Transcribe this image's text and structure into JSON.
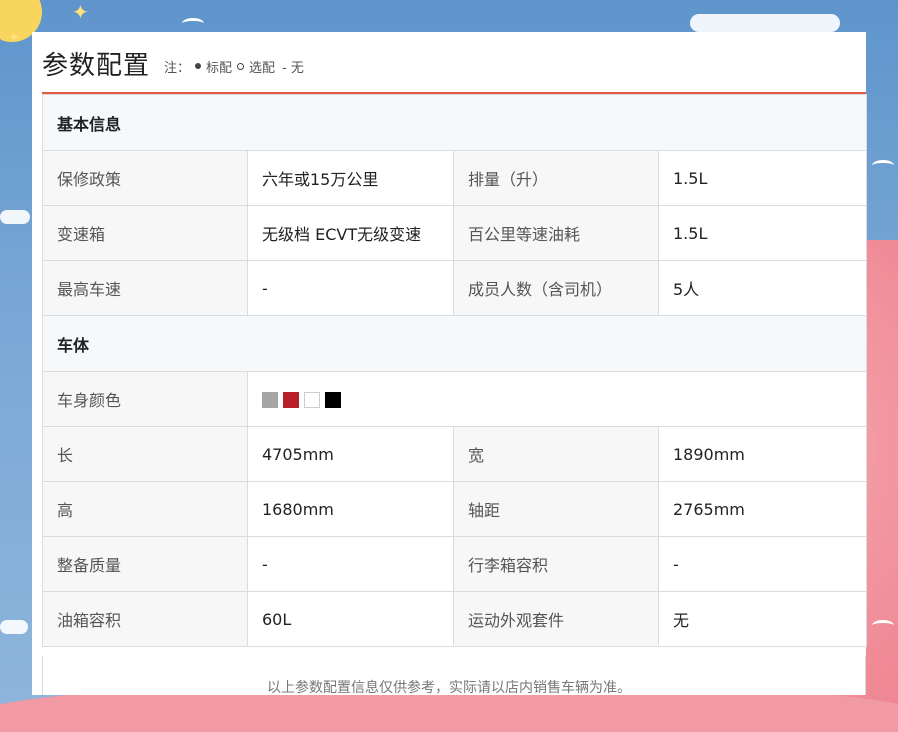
{
  "header": {
    "title": "参数配置",
    "note_prefix": "注：",
    "note_standard": "标配",
    "note_optional": "选配",
    "note_none": "- 无"
  },
  "sections": {
    "basic": {
      "title": "基本信息",
      "rows": [
        [
          {
            "label": "保修政策",
            "value": "六年或15万公里"
          },
          {
            "label": "排量（升）",
            "value": "1.5L"
          }
        ],
        [
          {
            "label": "变速箱",
            "value": "无级档 ECVT无级变速"
          },
          {
            "label": "百公里等速油耗",
            "value": "1.5L"
          }
        ],
        [
          {
            "label": "最高车速",
            "value": "-"
          },
          {
            "label": "成员人数（含司机）",
            "value": "5人"
          }
        ]
      ]
    },
    "body": {
      "title": "车体",
      "color_label": "车身颜色",
      "colors": [
        "#a6a6a6",
        "#b81e27",
        "#ffffff",
        "#000000"
      ],
      "rows": [
        [
          {
            "label": "长",
            "value": "4705mm"
          },
          {
            "label": "宽",
            "value": "1890mm"
          }
        ],
        [
          {
            "label": "高",
            "value": "1680mm"
          },
          {
            "label": "轴距",
            "value": "2765mm"
          }
        ],
        [
          {
            "label": "整备质量",
            "value": "-"
          },
          {
            "label": "行李箱容积",
            "value": "-"
          }
        ],
        [
          {
            "label": "油箱容积",
            "value": "60L"
          },
          {
            "label": "运动外观套件",
            "value": "无"
          }
        ]
      ]
    }
  },
  "footer": {
    "disclaimer": "以上参数配置信息仅供参考，实际请以店内销售车辆为准。"
  }
}
